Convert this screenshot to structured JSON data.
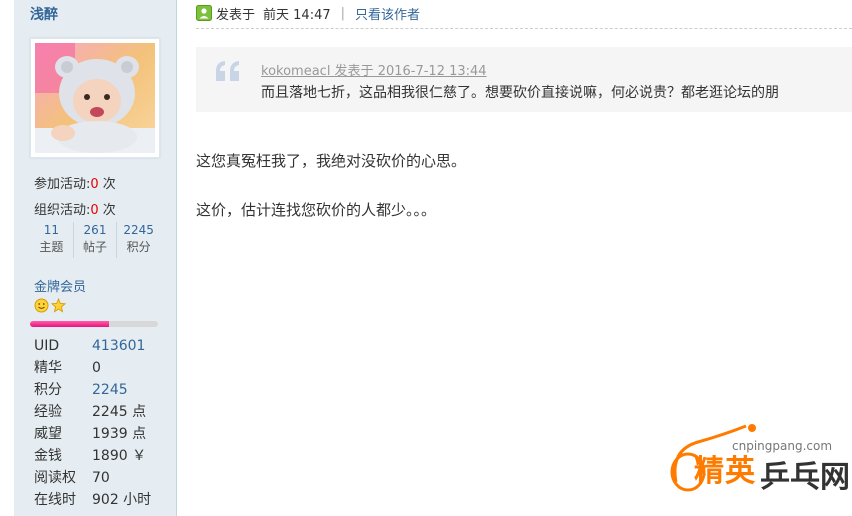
{
  "user": {
    "name": "浅醉",
    "activities": [
      {
        "label": "参加活动:",
        "count": "0",
        "unit": " 次"
      },
      {
        "label": "组织活动:",
        "count": "0",
        "unit": " 次"
      }
    ],
    "stats": [
      {
        "value": "11",
        "label": "主题"
      },
      {
        "value": "261",
        "label": "帖子"
      },
      {
        "value": "2245",
        "label": "积分"
      }
    ],
    "rank": "金牌会员",
    "level_progress": 0.62,
    "info": [
      {
        "key": "UID",
        "value": "413601",
        "link": true
      },
      {
        "key": "精华",
        "value": "0",
        "link": false
      },
      {
        "key": "积分",
        "value": "2245",
        "link": true
      },
      {
        "key": "经验",
        "value": "2245 点",
        "link": false
      },
      {
        "key": "威望",
        "value": "1939 点",
        "link": false
      },
      {
        "key": "金钱",
        "value": "1890 ￥",
        "link": false
      },
      {
        "key": "阅读权",
        "value": "70",
        "link": false
      },
      {
        "key": "在线时",
        "value": "902 小时",
        "link": false
      }
    ]
  },
  "post": {
    "posted_label": "发表于",
    "time": "前天 14:47",
    "separator": "|",
    "only_author": "只看该作者",
    "quote": {
      "meta": "kokomeacl 发表于 2016-7-12 13:44",
      "text": "而且落地七折，这品相我很仁慈了。想要砍价直接说嘛，何必说贵？都老逛论坛的朋"
    },
    "lines": [
      "这您真冤枉我了，我绝对没砍价的心思。",
      "这价，估计连找您砍价的人都少。。。"
    ]
  },
  "watermark": {
    "domain": "cnpingpang.com",
    "brand_left": "精英",
    "brand_right": "乒乓网"
  },
  "colors": {
    "sidebar_bg": "#e5edf2",
    "link": "#336699",
    "highlight": "#e60000",
    "progress": "#e8147c",
    "watermark_orange": "#ff7b00"
  }
}
